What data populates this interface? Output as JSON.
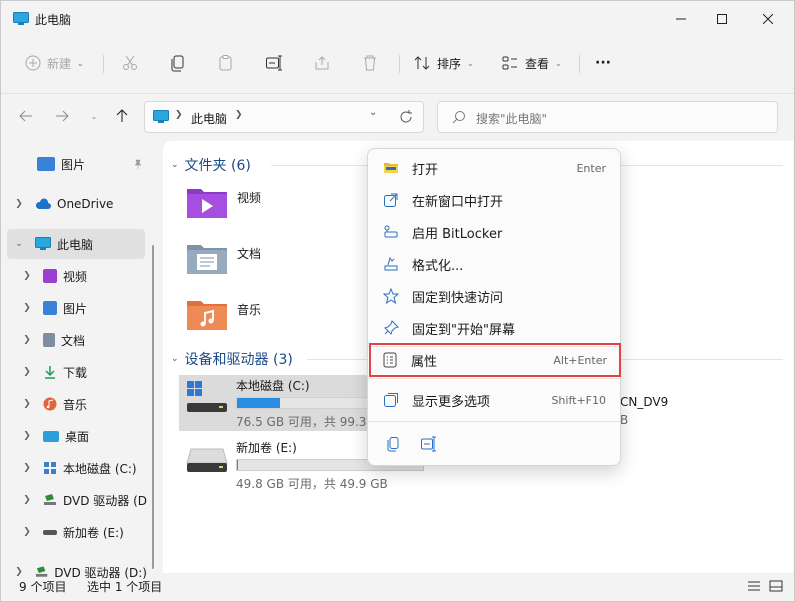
{
  "window": {
    "title": "此电脑"
  },
  "toolbar": {
    "new_label": "新建",
    "sort_label": "排序",
    "view_label": "查看",
    "more_label": "···"
  },
  "address": {
    "path": "此电脑",
    "search_placeholder": "搜索\"此电脑\""
  },
  "sidebar": {
    "items": [
      {
        "label": "图片",
        "icon": "picture-icon",
        "color": "#3a82d8"
      },
      {
        "label": "OneDrive",
        "icon": "cloud-icon",
        "color": "#1f72c9"
      },
      {
        "label": "此电脑",
        "icon": "computer-icon",
        "color": "#1ea2d6"
      },
      {
        "label": "视频",
        "icon": "video-icon",
        "color": "#9b3fd1"
      },
      {
        "label": "图片",
        "icon": "picture-icon",
        "color": "#3a82d8"
      },
      {
        "label": "文档",
        "icon": "document-icon",
        "color": "#6a7a8c"
      },
      {
        "label": "下载",
        "icon": "download-icon",
        "color": "#1c9a5a"
      },
      {
        "label": "音乐",
        "icon": "music-icon",
        "color": "#e0653a"
      },
      {
        "label": "桌面",
        "icon": "desktop-icon",
        "color": "#2a9fd9"
      },
      {
        "label": "本地磁盘 (C:)",
        "icon": "drive-icon",
        "color": "#3d7fce"
      },
      {
        "label": "DVD 驱动器 (D",
        "icon": "dvd-icon",
        "color": "#2d8c3a"
      },
      {
        "label": "新加卷 (E:)",
        "icon": "drive-icon",
        "color": "#666666"
      },
      {
        "label": "DVD 驱动器 (D:)",
        "icon": "dvd-icon",
        "color": "#2d8c3a"
      }
    ]
  },
  "content": {
    "folders_header": "文件夹 (6)",
    "folders": [
      {
        "label": "视频",
        "icon": "video-folder-icon"
      },
      {
        "label": "文档",
        "icon": "document-folder-icon"
      },
      {
        "label": "音乐",
        "icon": "music-folder-icon"
      }
    ],
    "drives_header": "设备和驱动器 (3)",
    "drives": [
      {
        "name": "本地磁盘 (C:)",
        "sub": "76.5 GB 可用，共 99.3",
        "used_fraction": 0.23
      },
      {
        "name": "新加卷 (E:)",
        "sub": "49.8 GB 可用，共 49.9 GB",
        "used_fraction": 0.002
      }
    ],
    "dvd_partial_name": "CN_DV9",
    "dvd_partial_sub": "B"
  },
  "context_menu": {
    "items": [
      {
        "label": "打开",
        "key": "Enter",
        "icon": "folder-open-icon"
      },
      {
        "label": "在新窗口中打开",
        "key": "",
        "icon": "open-new-window-icon"
      },
      {
        "label": "启用 BitLocker",
        "key": "",
        "icon": "bitlocker-key-icon"
      },
      {
        "label": "格式化...",
        "key": "",
        "icon": "format-drive-icon"
      },
      {
        "label": "固定到快速访问",
        "key": "",
        "icon": "star-icon"
      },
      {
        "label": "固定到\"开始\"屏幕",
        "key": "",
        "icon": "pin-icon"
      },
      {
        "label": "属性",
        "key": "Alt+Enter",
        "icon": "properties-icon"
      },
      {
        "label": "显示更多选项",
        "key": "Shift+F10",
        "icon": "more-options-icon"
      }
    ]
  },
  "status": {
    "count": "9 个项目",
    "selected": "选中 1 个项目"
  }
}
